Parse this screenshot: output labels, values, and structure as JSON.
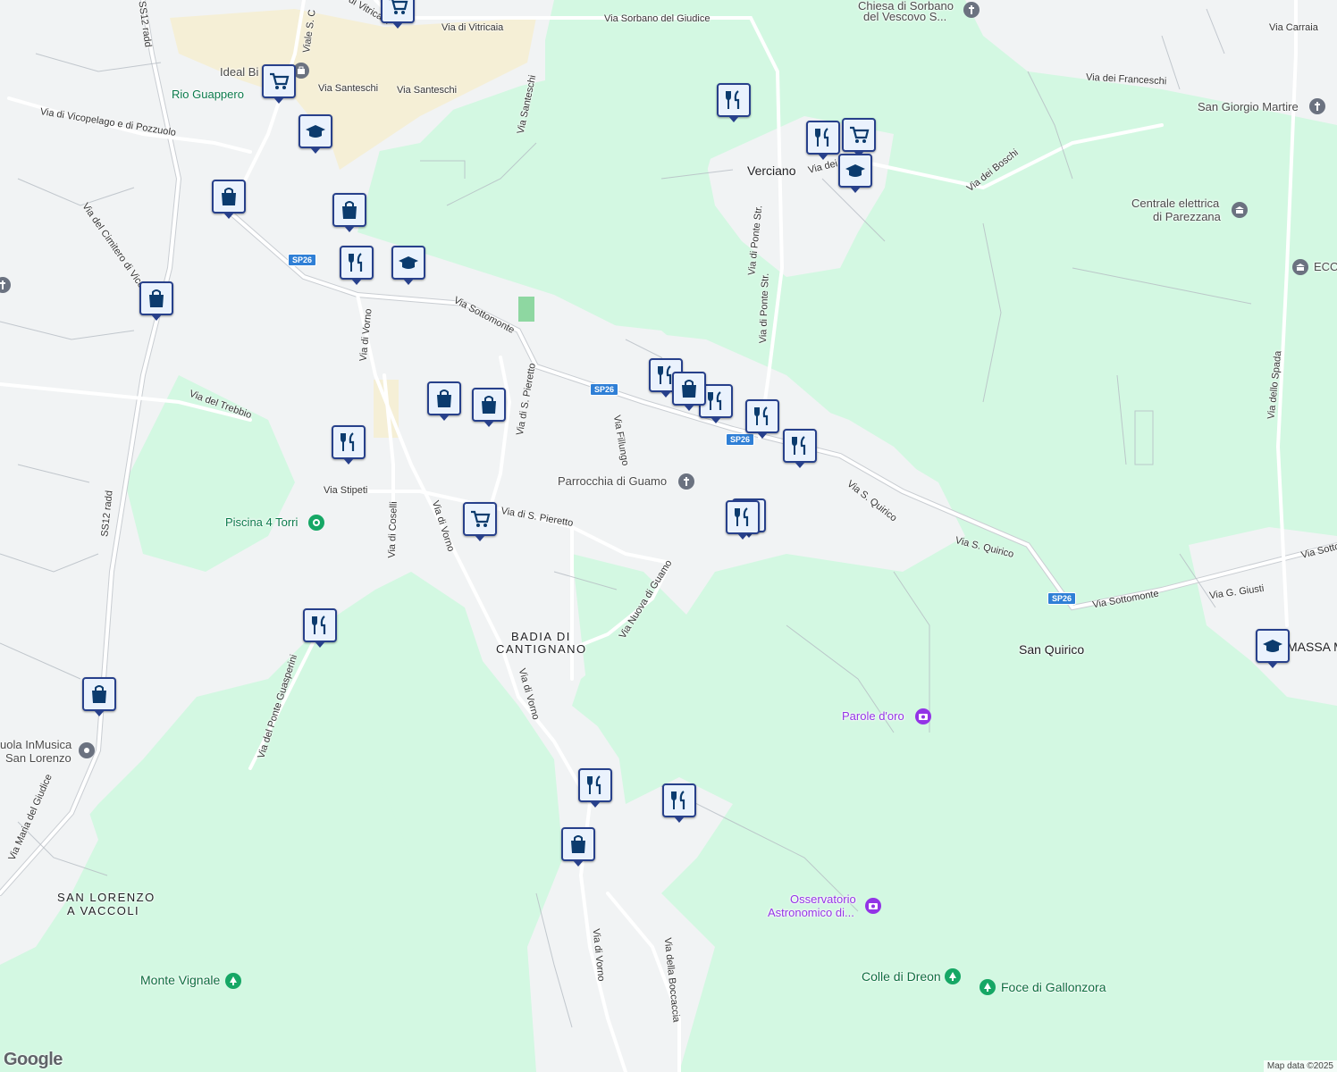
{
  "map": {
    "place_labels": [
      {
        "name": "place-verciano",
        "text": "Verciano"
      },
      {
        "name": "place-san-quirico",
        "text": "San Quirico"
      },
      {
        "name": "place-massa-macinaia",
        "text": "MASSA MACINA"
      }
    ],
    "district_labels": [
      {
        "name": "district-badia-line1",
        "text": "BADIA DI"
      },
      {
        "name": "district-badia-line2",
        "text": "CANTIGNANO"
      },
      {
        "name": "district-san-lorenzo-line1",
        "text": "SAN LORENZO"
      },
      {
        "name": "district-san-lorenzo-line2",
        "text": "A VACCOLI"
      }
    ],
    "road_labels": [
      "Via di Vitricaia",
      "Via di Vitricaia",
      "Via Sorbano del Giudice",
      "Via Carraia",
      "Via dei Franceschi",
      "Via Santeschi",
      "Via Santeschi",
      "Via Santeschi",
      "Via di Vicopelago e di Pozzuolo",
      "Via dei Boschi",
      "Via del Cimitero di Vico",
      "Via di Vorno",
      "Via Sottomonte",
      "Via del Trebbio",
      "Via di S. Pieretto",
      "Via Fillungo",
      "Via di Ponte Str.",
      "Via di Ponte Str.",
      "Via dello Spada",
      "Via Stipeti",
      "Via di S. Pieretto",
      "Via di Coselli",
      "Via di Vorno",
      "Via S. Quirico",
      "Via S. Quirico",
      "Via Sottomonte",
      "Via Sottomonte",
      "Via G. Giusti",
      "Via Nuova di Guamo",
      "Via di Vorno",
      "Via del Ponte Guasperini",
      "Via di Vorno",
      "Via della Boccaccia",
      "Via Maria del Giudice",
      "SS12 radd",
      "SS12 radd",
      "Viale S. C",
      "Via dei"
    ],
    "shields": [
      "SP26",
      "SP26",
      "SP26",
      "SP26"
    ],
    "poi_labels": [
      {
        "name": "poi-ideal-bi",
        "text": "Ideal Bi",
        "style": "poi-gray"
      },
      {
        "name": "poi-rio-guappero",
        "text": "Rio Guappero",
        "style": "poi-green"
      },
      {
        "name": "poi-chiesa-line1",
        "text": "Chiesa di Sorbano",
        "style": "poi-gray"
      },
      {
        "name": "poi-chiesa-line2",
        "text": "del Vescovo S...",
        "style": "poi-gray"
      },
      {
        "name": "poi-san-giorgio",
        "text": "San Giorgio Martire",
        "style": "poi-gray"
      },
      {
        "name": "poi-centrale-line1",
        "text": "Centrale elettrica",
        "style": "poi-gray"
      },
      {
        "name": "poi-centrale-line2",
        "text": "di Parezzana",
        "style": "poi-gray"
      },
      {
        "name": "poi-eco",
        "text": "ECO",
        "style": "poi-gray"
      },
      {
        "name": "poi-parrocchia",
        "text": "Parrocchia di Guamo",
        "style": "poi-gray"
      },
      {
        "name": "poi-piscina",
        "text": "Piscina 4 Torri",
        "style": "poi-green"
      },
      {
        "name": "poi-parole-doro",
        "text": "Parole d'oro",
        "style": "poi-purple"
      },
      {
        "name": "poi-scuola-line1",
        "text": "uola InMusica",
        "style": "poi-gray"
      },
      {
        "name": "poi-scuola-line2",
        "text": "San Lorenzo",
        "style": "poi-gray"
      },
      {
        "name": "poi-osservatorio-line1",
        "text": "Osservatorio",
        "style": "poi-purple"
      },
      {
        "name": "poi-osservatorio-line2",
        "text": "Astronomico di...",
        "style": "poi-purple"
      },
      {
        "name": "poi-monte-vignale",
        "text": "Monte Vignale",
        "style": "poi-green2"
      },
      {
        "name": "poi-colle-di-dreon",
        "text": "Colle di Dreon",
        "style": "poi-green2"
      },
      {
        "name": "poi-foce-di-gallonzora",
        "text": "Foce di Gallonzora",
        "style": "poi-green2"
      }
    ],
    "markers": [
      {
        "type": "grocery"
      },
      {
        "type": "grocery"
      },
      {
        "type": "grocery"
      },
      {
        "type": "grocery"
      },
      {
        "type": "restaurant"
      },
      {
        "type": "restaurant"
      },
      {
        "type": "restaurant"
      },
      {
        "type": "restaurant"
      },
      {
        "type": "restaurant"
      },
      {
        "type": "restaurant"
      },
      {
        "type": "restaurant"
      },
      {
        "type": "restaurant"
      },
      {
        "type": "restaurant"
      },
      {
        "type": "restaurant"
      },
      {
        "type": "restaurant"
      },
      {
        "type": "restaurant"
      },
      {
        "type": "restaurant"
      },
      {
        "type": "school"
      },
      {
        "type": "school"
      },
      {
        "type": "school"
      },
      {
        "type": "school"
      },
      {
        "type": "shopping"
      },
      {
        "type": "shopping"
      },
      {
        "type": "shopping"
      },
      {
        "type": "shopping"
      },
      {
        "type": "shopping"
      },
      {
        "type": "shopping"
      },
      {
        "type": "shopping"
      },
      {
        "type": "shopping"
      },
      {
        "type": "shopping"
      }
    ],
    "colors": {
      "park": "#d3f8e2",
      "urban": "#f1f3f4",
      "sand": "#f5efd6",
      "road": "#ffffff",
      "road_outline": "#c9cdd2",
      "shield": "#2f7fd6",
      "marker_border": "#27408b",
      "marker_fill": "#eaf2fd",
      "icon": "#0b3b6e",
      "water": "#aadaff"
    },
    "attribution": {
      "logo": "Google",
      "data": "Map data ©2025"
    }
  }
}
